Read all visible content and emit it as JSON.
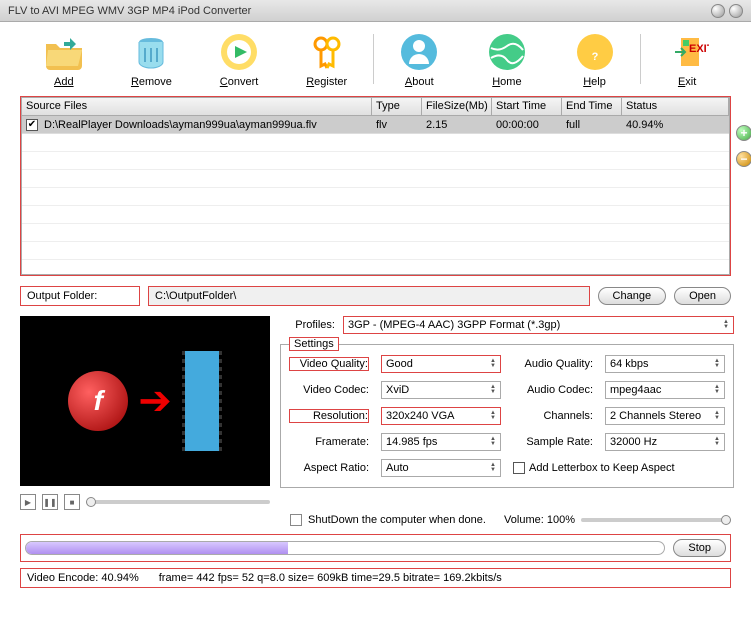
{
  "title": "FLV to AVI MPEG WMV 3GP MP4 iPod Converter",
  "toolbar": {
    "add": "Add",
    "remove": "Remove",
    "convert": "Convert",
    "register": "Register",
    "about": "About",
    "home": "Home",
    "help": "Help",
    "exit": "Exit"
  },
  "table": {
    "headers": {
      "source": "Source Files",
      "type": "Type",
      "size": "FileSize(Mb)",
      "start": "Start Time",
      "end": "End Time",
      "status": "Status"
    },
    "rows": [
      {
        "checked": true,
        "file": "D:\\RealPlayer Downloads\\ayman999ua\\ayman999ua.flv",
        "type": "flv",
        "size": "2.15",
        "start": "00:00:00",
        "end": "full",
        "status": "40.94%"
      }
    ]
  },
  "output": {
    "label": "Output Folder:",
    "path": "C:\\OutputFolder\\",
    "change": "Change",
    "open": "Open"
  },
  "profiles": {
    "label": "Profiles:",
    "value": "3GP - (MPEG-4 AAC) 3GPP Format (*.3gp)"
  },
  "settings": {
    "legend": "Settings",
    "videoQuality": {
      "label": "Video Quality:",
      "value": "Good"
    },
    "videoCodec": {
      "label": "Video Codec:",
      "value": "XviD"
    },
    "resolution": {
      "label": "Resolution:",
      "value": "320x240 VGA"
    },
    "framerate": {
      "label": "Framerate:",
      "value": "14.985 fps"
    },
    "aspectRatio": {
      "label": "Aspect Ratio:",
      "value": "Auto"
    },
    "audioQuality": {
      "label": "Audio Quality:",
      "value": "64  kbps"
    },
    "audioCodec": {
      "label": "Audio Codec:",
      "value": "mpeg4aac"
    },
    "channels": {
      "label": "Channels:",
      "value": "2 Channels Stereo"
    },
    "sampleRate": {
      "label": "Sample Rate:",
      "value": "32000 Hz"
    },
    "letterbox": "Add Letterbox to Keep Aspect"
  },
  "shutdown": "ShutDown the computer when done.",
  "volume": {
    "label": "Volume:",
    "value": "100%"
  },
  "stop": "Stop",
  "encode": {
    "label": "Video Encode: 40.94%",
    "stats": "frame=  442 fps= 52 q=8.0 size=     609kB time=29.5 bitrate= 169.2kbits/s"
  },
  "colors": {
    "highlight": "#d44"
  }
}
